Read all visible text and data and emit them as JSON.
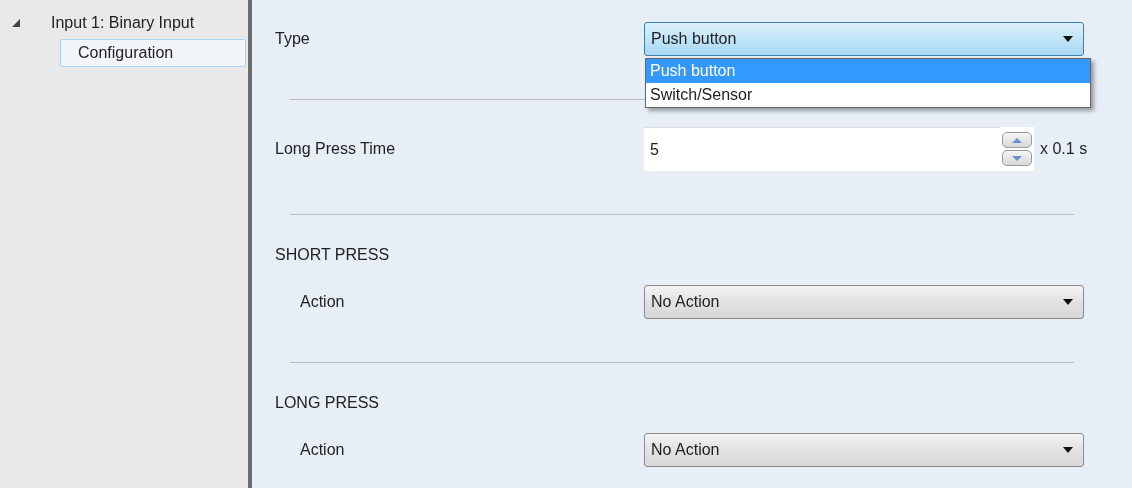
{
  "sidebar": {
    "tree": [
      {
        "label": "Input 1: Binary Input",
        "expanded": true,
        "selected": false,
        "children": [
          {
            "label": "Configuration",
            "selected": true
          }
        ]
      }
    ]
  },
  "form": {
    "items": [
      {
        "kind": "select",
        "label": "Type",
        "value": "Push button",
        "open": true,
        "focused": true,
        "options": [
          {
            "label": "Push button",
            "selected": true
          },
          {
            "label": "Switch/Sensor",
            "selected": false
          }
        ]
      },
      {
        "kind": "divider"
      },
      {
        "kind": "spin",
        "label": "Long Press Time",
        "value": "5",
        "unit": "x 0.1 s"
      },
      {
        "kind": "divider"
      },
      {
        "kind": "section",
        "title": "SHORT PRESS",
        "children": [
          {
            "kind": "select",
            "label": "Action",
            "value": "No Action",
            "open": false,
            "focused": false
          }
        ]
      },
      {
        "kind": "divider"
      },
      {
        "kind": "section",
        "title": "LONG PRESS",
        "children": [
          {
            "kind": "select",
            "label": "Action",
            "value": "No Action",
            "open": false,
            "focused": false
          }
        ]
      }
    ]
  }
}
